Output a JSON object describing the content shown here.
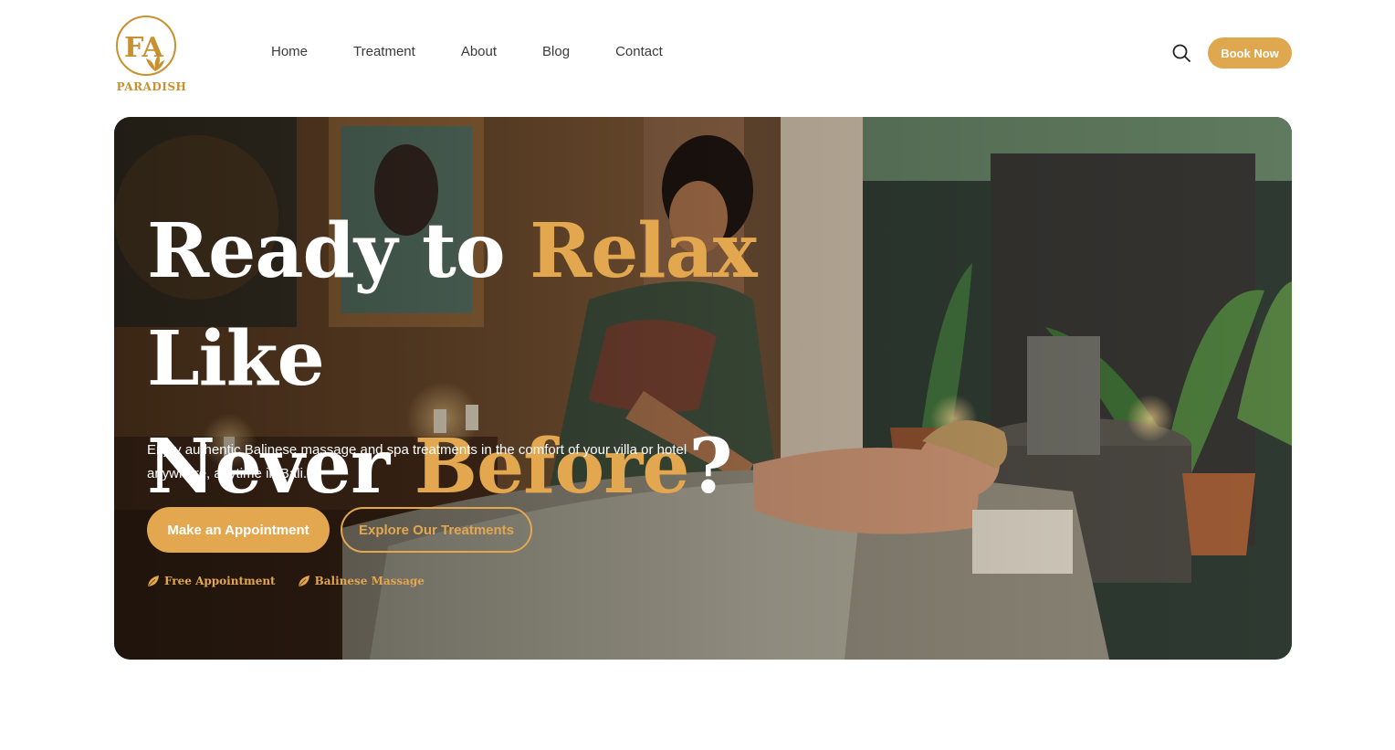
{
  "brand": {
    "logo_monogram": "FA",
    "name": "PARADISH",
    "color": "#c8902f"
  },
  "nav": {
    "items": [
      "Home",
      "Treatment",
      "About",
      "Blog",
      "Contact"
    ]
  },
  "header": {
    "search_icon": "search-icon",
    "book_label": "Book Now"
  },
  "hero": {
    "title_part1": "Ready to ",
    "title_highlight1": "Relax",
    "title_part2": " Like",
    "title_part3": "Never ",
    "title_highlight2": "Before",
    "title_part4": "?",
    "description": "Enjoy authentic Balinese massage and spa treatments in the comfort of your villa or hotel anywhere, anytime in Bali.",
    "primary_button": "Make an Appointment",
    "secondary_button": "Explore Our Treatments",
    "features": [
      {
        "icon": "leaf-icon",
        "label": "Free Appointment"
      },
      {
        "icon": "leaf-icon",
        "label": "Balinese Massage"
      }
    ]
  },
  "colors": {
    "accent": "#e2a74f",
    "text_dark": "#3a3a3a",
    "white": "#ffffff"
  }
}
